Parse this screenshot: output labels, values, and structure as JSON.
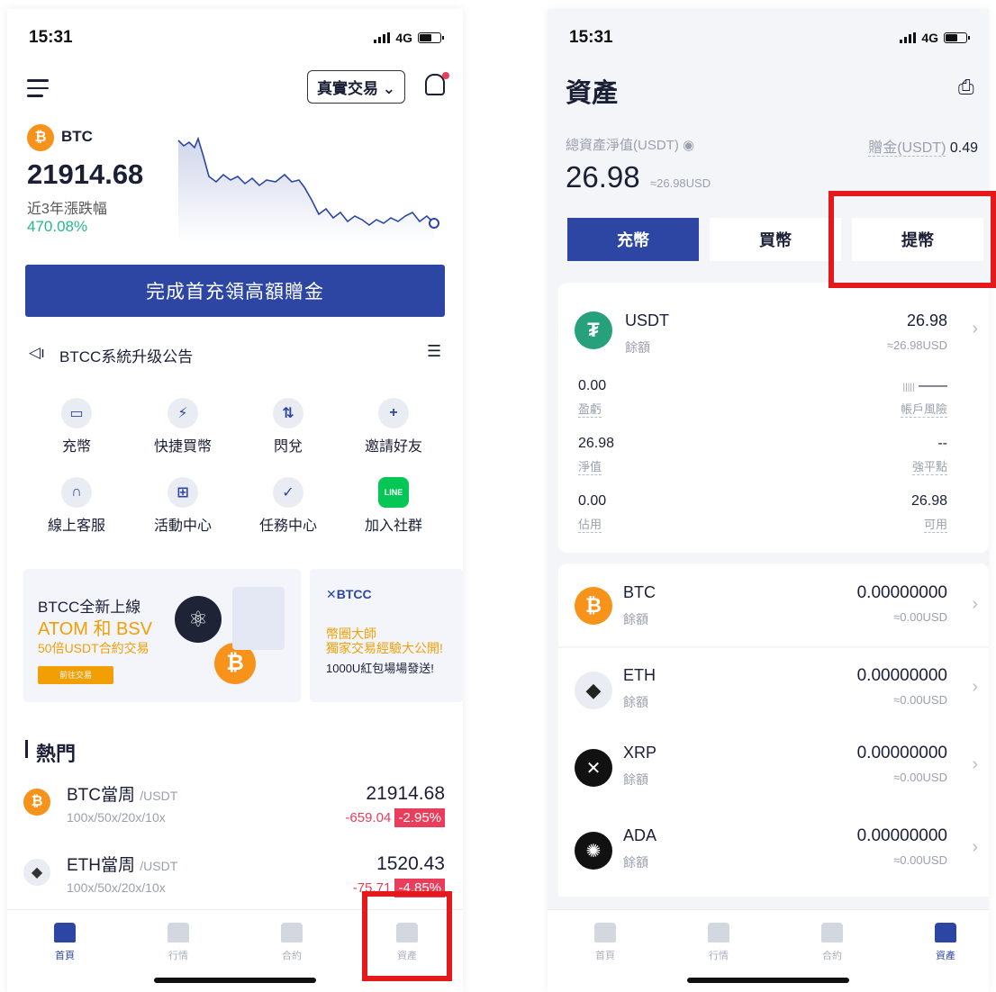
{
  "left": {
    "status_time": "15:31",
    "network": "4G",
    "mode_button": "真實交易",
    "ticker": {
      "symbol": "BTC",
      "price": "21914.68",
      "change_label": "近3年漲跌幅",
      "change_value": "470.08%"
    },
    "cta": "完成首充領高額贈金",
    "announcement": "BTCC系統升级公告",
    "grid": [
      {
        "label": "充幣",
        "icon": "card-icon"
      },
      {
        "label": "快捷買幣",
        "icon": "lightning-icon"
      },
      {
        "label": "閃兌",
        "icon": "swap-icon"
      },
      {
        "label": "邀請好友",
        "icon": "add-user-icon"
      },
      {
        "label": "線上客服",
        "icon": "headset-icon"
      },
      {
        "label": "活動中心",
        "icon": "gift-icon"
      },
      {
        "label": "任務中心",
        "icon": "checklist-icon"
      },
      {
        "label": "加入社群",
        "icon": "line-icon"
      }
    ],
    "banner1": {
      "line1": "BTCC全新上線",
      "line2": "ATOM 和 BSV",
      "line3": "50倍USDT合約交易",
      "button": "前往交易"
    },
    "banner2": {
      "brand": "BTCC",
      "line1": "幣圈大師",
      "line2": "獨家交易經驗大公開!",
      "line3": "1000U紅包場場發送!"
    },
    "hot_title": "熱門",
    "hot": [
      {
        "name": "BTC當周",
        "quote": "/USDT",
        "leverage": "100x/50x/20x/10x",
        "price": "21914.68",
        "change": "-659.04",
        "pct": "-2.95%"
      },
      {
        "name": "ETH當周",
        "quote": "/USDT",
        "leverage": "100x/50x/20x/10x",
        "price": "1520.43",
        "change": "-75.71",
        "pct": "-4.85%"
      }
    ],
    "tabs": [
      "首頁",
      "行情",
      "合約",
      "資產"
    ]
  },
  "right": {
    "status_time": "15:31",
    "network": "4G",
    "title": "資產",
    "net_label": "總資產淨值(USDT)",
    "bonus_label": "贈金(USDT)",
    "bonus_value": "0.49",
    "total": "26.98",
    "total_usd": "≈26.98USD",
    "actions": [
      "充幣",
      "買幣",
      "提幣"
    ],
    "usdt": {
      "name": "USDT",
      "sub": "餘額",
      "amount": "26.98",
      "usd": "≈26.98USD",
      "pnl": "0.00",
      "pnl_label": "盈虧",
      "risk": "——",
      "risk_label": "帳戶風險",
      "equity": "26.98",
      "equity_label": "淨值",
      "liq": "--",
      "liq_label": "強平點",
      "used": "0.00",
      "used_label": "佔用",
      "avail": "26.98",
      "avail_label": "可用"
    },
    "assets": [
      {
        "name": "BTC",
        "sub": "餘額",
        "amount": "0.00000000",
        "usd": "≈0.00USD"
      },
      {
        "name": "ETH",
        "sub": "餘額",
        "amount": "0.00000000",
        "usd": "≈0.00USD"
      },
      {
        "name": "XRP",
        "sub": "餘額",
        "amount": "0.00000000",
        "usd": "≈0.00USD"
      },
      {
        "name": "ADA",
        "sub": "餘額",
        "amount": "0.00000000",
        "usd": "≈0.00USD"
      }
    ],
    "tabs": [
      "首頁",
      "行情",
      "合約",
      "資產"
    ]
  },
  "colors": {
    "brand": "#2d46a3",
    "highlight": "#e3191b",
    "up": "#26b889",
    "down": "#e93d5b"
  }
}
